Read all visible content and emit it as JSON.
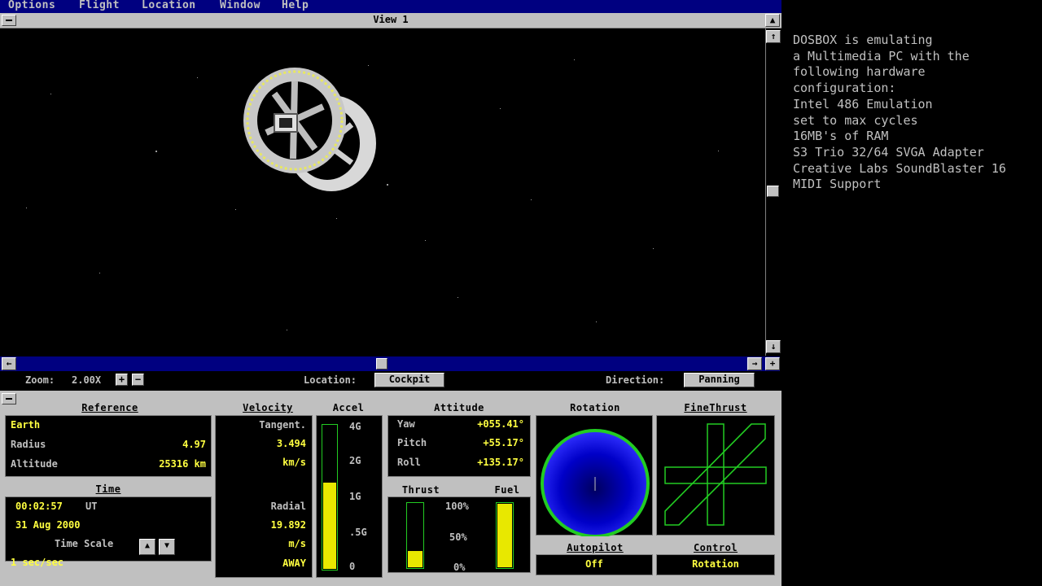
{
  "menu": {
    "items": [
      "Options",
      "Flight",
      "Location",
      "Window",
      "Help"
    ]
  },
  "view": {
    "title": "View 1"
  },
  "zoombar": {
    "zoom_label": "Zoom:",
    "zoom_value": "2.00X",
    "zoom_in": "+",
    "zoom_out": "−",
    "location_label": "Location:",
    "location_value": "Cockpit",
    "direction_label": "Direction:",
    "direction_value": "Panning"
  },
  "reference": {
    "title": "Reference",
    "body": "Earth",
    "radius_label": "Radius",
    "radius_value": "4.97",
    "altitude_label": "Altitude",
    "altitude_value": "25316 km"
  },
  "time": {
    "title": "Time",
    "clock": "00:02:57",
    "zone": "UT",
    "date": "31 Aug 2000",
    "scale_label": "Time Scale",
    "scale_value": "1 sec/sec"
  },
  "velocity": {
    "title": "Velocity",
    "tangent_label": "Tangent.",
    "tangent_value": "3.494",
    "tangent_unit": "km/s",
    "radial_label": "Radial",
    "radial_value": "19.892",
    "radial_unit": "m/s",
    "radial_dir": "AWAY"
  },
  "accel": {
    "title": "Accel",
    "ticks": [
      "4G",
      "2G",
      "1G",
      ".5G",
      "0"
    ],
    "level": 0.6
  },
  "attitude": {
    "title": "Attitude",
    "yaw_label": "Yaw",
    "yaw_value": "+055.41°",
    "pitch_label": "Pitch",
    "pitch_value": "+55.17°",
    "roll_label": "Roll",
    "roll_value": "+135.17°"
  },
  "thrust": {
    "title": "Thrust",
    "fuel_title": "Fuel",
    "ticks": [
      "100%",
      "50%",
      "0%"
    ],
    "thrust_level": 0.25,
    "fuel_level": 1.0
  },
  "rotation": {
    "title": "Rotation"
  },
  "finethrust": {
    "title": "FineThrust"
  },
  "autopilot": {
    "title": "Autopilot",
    "value": "Off"
  },
  "control": {
    "title": "Control",
    "value": "Rotation"
  },
  "dosbox": {
    "lines": [
      "DOSBOX is emulating",
      "a Multimedia PC with the",
      "following hardware",
      "configuration:",
      "Intel 486 Emulation",
      "set to max cycles",
      "16MB's of RAM",
      "S3 Trio 32/64 SVGA Adapter",
      "Creative Labs SoundBlaster 16",
      "MIDI Support"
    ]
  },
  "colors": {
    "panel": "#c0c0c0",
    "readout": "#ffff40",
    "menubar": "#000080",
    "green": "#22cc22",
    "blue": "#1010e0"
  }
}
